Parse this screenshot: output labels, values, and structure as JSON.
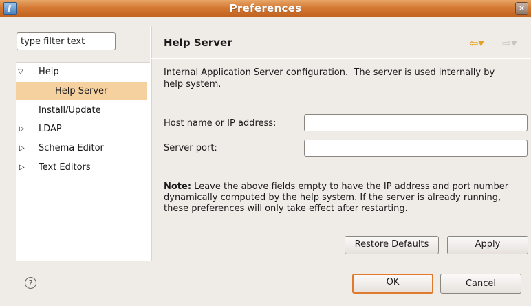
{
  "window": {
    "title": "Preferences",
    "close_glyph": "✕",
    "icon": "eclipse-app-icon"
  },
  "filter": {
    "placeholder": "type filter text",
    "value": "type filter text"
  },
  "tree": {
    "items": [
      {
        "label": "Help",
        "expander": "▽",
        "expanded": true
      },
      {
        "label": "Help Server",
        "selected": true
      },
      {
        "label": "Install/Update"
      },
      {
        "label": "LDAP",
        "expander": "▷"
      },
      {
        "label": "Schema Editor",
        "expander": "▷"
      },
      {
        "label": "Text Editors",
        "expander": "▷"
      }
    ]
  },
  "page": {
    "title": "Help Server",
    "nav_back": "⇦▾",
    "nav_forward": "⇨▾",
    "description": "Internal Application Server configuration.  The server is used internally by help system.",
    "host_label_mnemonic": "H",
    "host_label_rest": "ost name or IP address:",
    "host_value": "",
    "port_label": "Server port:",
    "port_value": "",
    "note_bold": "Note:",
    "note_text": " Leave the above fields empty to have the IP address and port number dynamically computed by the help system. If the server is already running, these preferences will only take effect after restarting."
  },
  "buttons": {
    "restore_prefix": "Restore ",
    "restore_mnemonic": "D",
    "restore_suffix": "efaults",
    "apply_mnemonic": "A",
    "apply_suffix": "pply",
    "ok": "OK",
    "cancel": "Cancel",
    "help_glyph": "?"
  },
  "colors": {
    "title_bar": "#d57a35",
    "selection": "#f5d19f",
    "default_button_border": "#e07a2c"
  }
}
